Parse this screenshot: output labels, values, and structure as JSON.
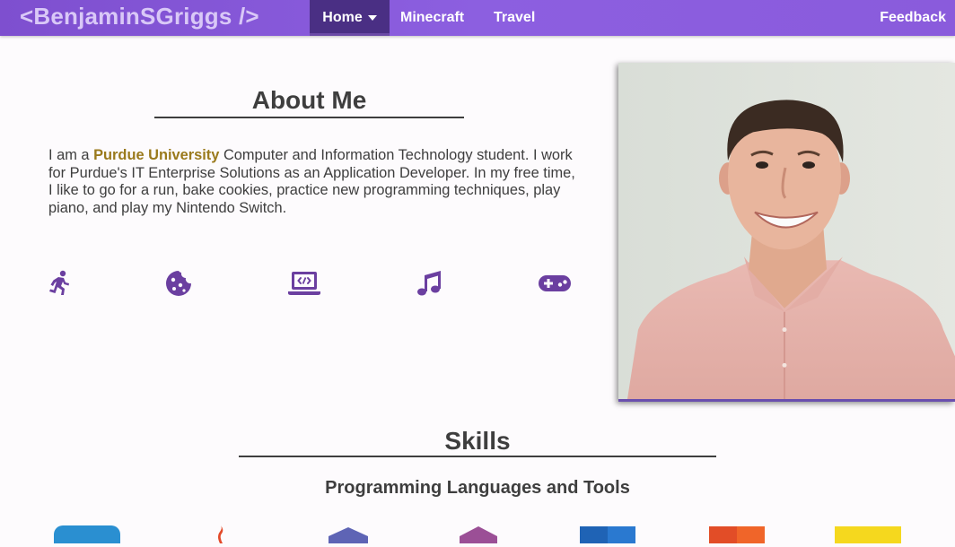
{
  "navbar": {
    "brand": "<BenjaminSGriggs />",
    "items": [
      {
        "label": "Home",
        "active": true,
        "has_dropdown": true
      },
      {
        "label": "Minecraft"
      },
      {
        "label": "Travel"
      }
    ],
    "feedback_label": "Feedback",
    "colors": {
      "bar": "#8a5bdc",
      "active": "#4a2f84"
    }
  },
  "about": {
    "title": "About Me",
    "intro_prefix": "I am a ",
    "highlight": "Purdue University",
    "body": " Computer and Information Technology student. I work for Purdue's IT Enterprise Solutions as an Application Developer. In my free time, I like to go for a run, bake cookies, practice new programming techniques, play piano, and play my Nintendo Switch.",
    "highlight_color": "#9a7a1c",
    "hobby_icons": [
      "running-icon",
      "cookie-icon",
      "laptop-code-icon",
      "music-icon",
      "gamepad-icon"
    ],
    "icon_color": "#6b3fa0"
  },
  "skills": {
    "title": "Skills",
    "subtitle": "Programming Languages and Tools",
    "logo_icons": [
      "blue-logo-icon",
      "java-logo-icon",
      "php-logo-icon",
      "csharp-logo-icon",
      "css3-logo-icon",
      "html5-logo-icon",
      "js-logo-icon"
    ]
  }
}
